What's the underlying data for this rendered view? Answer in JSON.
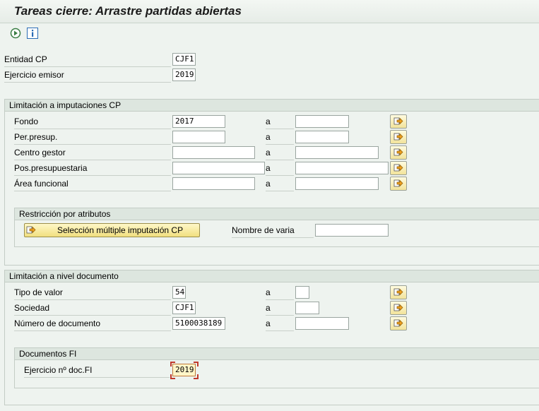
{
  "window": {
    "title": "Tareas cierre: Arrastre partidas abiertas"
  },
  "toolbar": {
    "execute_icon": "execute-icon",
    "info_icon": "info-icon"
  },
  "header_fields": {
    "entidad_label": "Entidad CP",
    "entidad_value": "CJF1",
    "ejercicio_label": "Ejercicio emisor",
    "ejercicio_value": "2019"
  },
  "limit_cp": {
    "title": "Limitación a imputaciones CP",
    "to_label": "a",
    "rows": [
      {
        "label": "Fondo",
        "from": "2017",
        "to": ""
      },
      {
        "label": "Per.presup.",
        "from": "",
        "to": ""
      },
      {
        "label": "Centro gestor",
        "from": "",
        "to": ""
      },
      {
        "label": "Pos.presupuestaria",
        "from": "",
        "to": ""
      },
      {
        "label": "Área funcional",
        "from": "",
        "to": ""
      }
    ],
    "restriction": {
      "title": "Restricción por atributos",
      "multi_button": "Selección múltiple imputación CP",
      "variant_label": "Nombre de varia",
      "variant_value": ""
    }
  },
  "limit_doc": {
    "title": "Limitación a nivel documento",
    "to_label": "a",
    "rows": [
      {
        "label": "Tipo de valor",
        "from": "54",
        "to": ""
      },
      {
        "label": "Sociedad",
        "from": "CJF1",
        "to": ""
      },
      {
        "label": "Número de documento",
        "from": "5100038189",
        "to": ""
      }
    ],
    "fi": {
      "title": "Documentos FI",
      "year_label": "Ejercicio nº doc.FI",
      "year_value": "2019"
    }
  },
  "colors": {
    "background": "#eef3ef",
    "group_header": "#dde6df",
    "focus_field": "#fff6c8"
  }
}
